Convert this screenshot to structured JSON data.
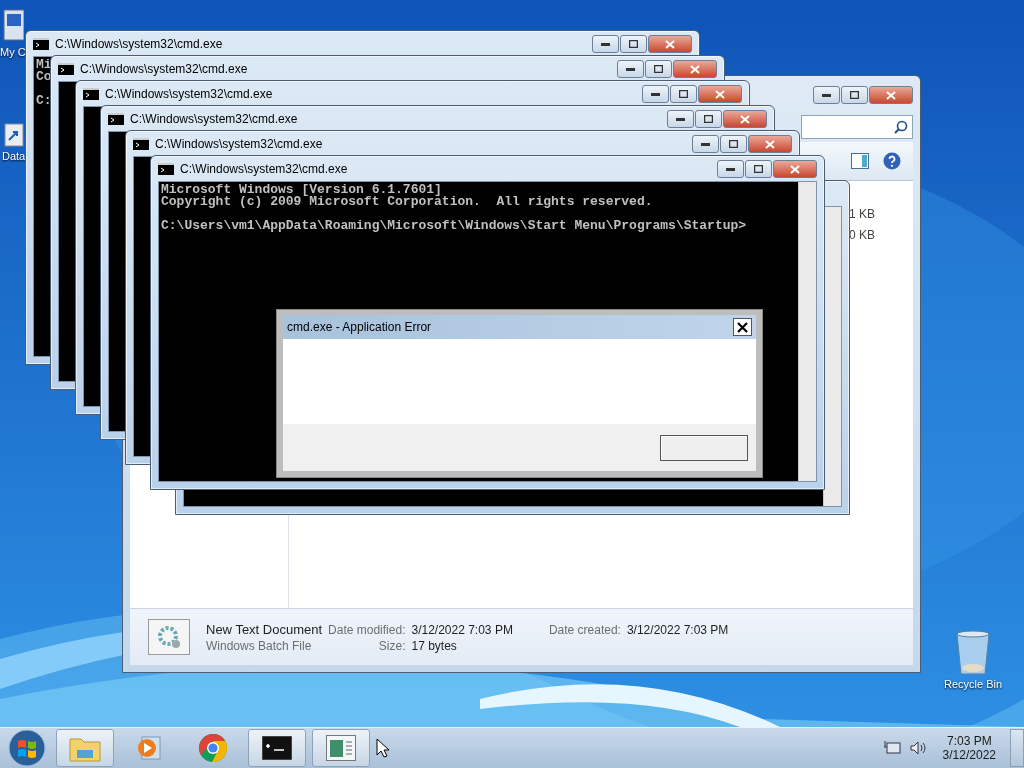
{
  "desktop_icons": [
    {
      "kind": "computer",
      "label": "My C"
    },
    {
      "kind": "shortcut",
      "label": "Data"
    },
    {
      "kind": "recycle",
      "label": "Recycle Bin"
    }
  ],
  "explorer": {
    "file_sizes": [
      "1 KB",
      "0 KB"
    ],
    "details": {
      "name": "New Text Document",
      "type": "Windows Batch File",
      "modified_label": "Date modified:",
      "modified": "3/12/2022 7:03 PM",
      "size_label": "Size:",
      "size": "17 bytes",
      "created_label": "Date created:",
      "created": "3/12/2022 7:03 PM"
    }
  },
  "cmd_windows": [
    {
      "title": "C:\\Windows\\system32\\cmd.exe",
      "console": [
        [
          "Mi",
          "Co"
        ],
        [
          "C:"
        ]
      ]
    },
    {
      "title": "C:\\Windows\\system32\\cmd.exe"
    },
    {
      "title": "C:\\Windows\\system32\\cmd.exe"
    },
    {
      "title": "C:\\Windows\\system32\\cmd.exe"
    },
    {
      "title": "C:\\Windows\\system32\\cmd.exe"
    },
    {
      "title": "C:\\Windows\\system32\\cmd.exe",
      "console": [
        [
          "Microsoft Windows [Version 6.1.7601]",
          "Copyright (c) 2009 Microsoft Corporation.  All rights reserved."
        ],
        [
          "C:\\Users\\vm1\\AppData\\Roaming\\Microsoft\\Windows\\Start Menu\\Programs\\Startup>"
        ]
      ]
    },
    {
      "kind": "hidden"
    }
  ],
  "error_dialog": {
    "title": "cmd.exe - Application Error"
  },
  "taskbar": {
    "items": [
      {
        "kind": "explorer",
        "open": true
      },
      {
        "kind": "media",
        "open": false
      },
      {
        "kind": "chrome",
        "open": false
      },
      {
        "kind": "cmd",
        "open": true
      },
      {
        "kind": "app",
        "open": true
      }
    ],
    "time": "7:03 PM",
    "date": "3/12/2022"
  }
}
